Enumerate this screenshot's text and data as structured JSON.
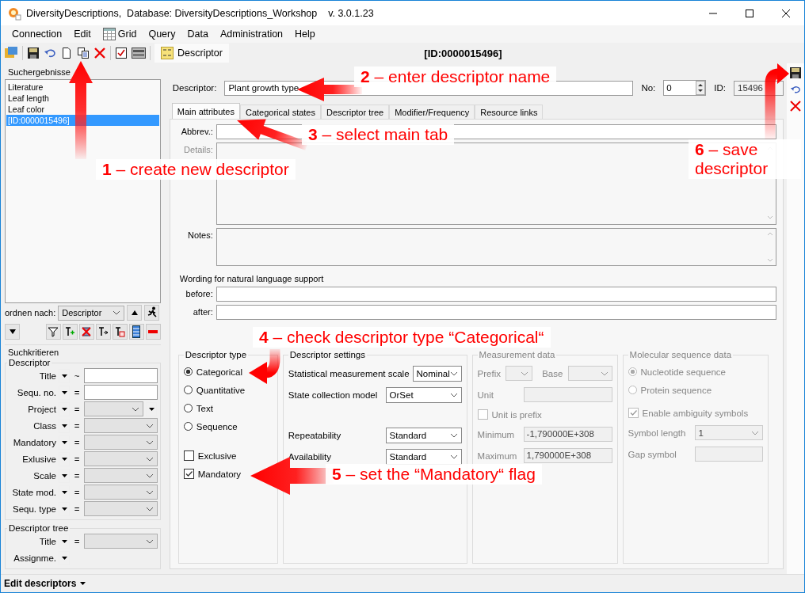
{
  "window": {
    "title": "DiversityDescriptions,  Database: DiversityDescriptions_Workshop    v. 3.0.1.23"
  },
  "menu": [
    {
      "label": "Connection",
      "has_icon": false
    },
    {
      "label": "Edit",
      "has_icon": false
    },
    {
      "label": "Grid",
      "has_icon": true
    },
    {
      "label": "Query",
      "has_icon": false
    },
    {
      "label": "Data",
      "has_icon": false
    },
    {
      "label": "Administration",
      "has_icon": false
    },
    {
      "label": "Help",
      "has_icon": false
    }
  ],
  "toolbar": {
    "tab": "Descriptor",
    "record_id": "[ID:0000015496]"
  },
  "search_results": {
    "title": "Suchergebnisse",
    "items": [
      {
        "label": "Literature",
        "selected": false
      },
      {
        "label": "Leaf length",
        "selected": false
      },
      {
        "label": "Leaf color",
        "selected": false
      },
      {
        "label": "[ID:0000015496]",
        "selected": true
      }
    ],
    "sort_label": "ordnen nach:",
    "sort_value": "Descriptor"
  },
  "search_criteria": {
    "title": "Suchkritieren",
    "groups": [
      {
        "title": "Descriptor",
        "rows": [
          {
            "label": "Title",
            "op": "~",
            "kind": "text"
          },
          {
            "label": "Sequ. no.",
            "op": "=",
            "kind": "text"
          },
          {
            "label": "Project",
            "op": "=",
            "kind": "combo-extra"
          },
          {
            "label": "Class",
            "op": "=",
            "kind": "combo"
          },
          {
            "label": "Mandatory",
            "op": "=",
            "kind": "combo"
          },
          {
            "label": "Exlusive",
            "op": "=",
            "kind": "combo"
          },
          {
            "label": "Scale",
            "op": "=",
            "kind": "combo"
          },
          {
            "label": "State mod.",
            "op": "=",
            "kind": "combo"
          },
          {
            "label": "Sequ. type",
            "op": "=",
            "kind": "combo"
          }
        ]
      },
      {
        "title": "Descriptor tree",
        "rows": [
          {
            "label": "Title",
            "op": "=",
            "kind": "combo"
          },
          {
            "label": "Assignme.",
            "kind": "none"
          }
        ]
      }
    ]
  },
  "descriptor": {
    "label": "Descriptor:",
    "value": "Plant growth type",
    "no_label": "No:",
    "no": "0",
    "id_label": "ID:",
    "id": "15496"
  },
  "tabs": [
    {
      "label": "Main attributes",
      "selected": true
    },
    {
      "label": "Categorical states",
      "selected": false
    },
    {
      "label": "Descriptor tree",
      "selected": false
    },
    {
      "label": "Modifier/Frequency",
      "selected": false
    },
    {
      "label": "Resource links",
      "selected": false
    }
  ],
  "main": {
    "abbrev_label": "Abbrev.:",
    "details_label": "Details:",
    "notes_label": "Notes:",
    "wording_title": "Wording for natural language support",
    "before_label": "before:",
    "after_label": "after:"
  },
  "descriptor_type": {
    "title": "Descriptor type",
    "options": [
      {
        "label": "Categorical",
        "selected": true
      },
      {
        "label": "Quantitative",
        "selected": false
      },
      {
        "label": "Text",
        "selected": false
      },
      {
        "label": "Sequence",
        "selected": false
      }
    ],
    "flags": [
      {
        "label": "Exclusive",
        "checked": false
      },
      {
        "label": "Mandatory",
        "checked": true
      }
    ]
  },
  "settings": {
    "title": "Descriptor settings",
    "fields": [
      {
        "label": "Statistical measurement scale",
        "value": "Nominal"
      },
      {
        "label": "State collection model",
        "value": "OrSet"
      },
      {
        "label": "Repeatability",
        "value": "Standard"
      },
      {
        "label": "Availability",
        "value": "Standard"
      }
    ]
  },
  "measurement": {
    "title": "Measurement data",
    "disabled": true,
    "prefix_label": "Prefix",
    "base_label": "Base",
    "unit_label": "Unit",
    "unit_is_prefix": {
      "label": "Unit is prefix",
      "checked": false
    },
    "min_label": "Minimum",
    "min": "-1,790000E+308",
    "max_label": "Maximum",
    "max": "1,790000E+308"
  },
  "sequence": {
    "title": "Molecular sequence data",
    "disabled": true,
    "options": [
      {
        "label": "Nucleotide sequence",
        "selected": true
      },
      {
        "label": "Protein sequence",
        "selected": false
      }
    ],
    "ambiguity": {
      "label": "Enable ambiguity symbols",
      "checked": true
    },
    "symbol_length_label": "Symbol length",
    "symbol_length": "1",
    "gap_label": "Gap symbol"
  },
  "status_bar": {
    "label": "Edit descriptors"
  },
  "annotations": [
    {
      "text": "**1** – create new descriptor"
    },
    {
      "text": "**2** – enter descriptor name"
    },
    {
      "text": "**3** – select main tab"
    },
    {
      "text": "**4** – check descriptor type “Categorical“"
    },
    {
      "text": "**5** – set the “Mandatory“ flag"
    },
    {
      "text": "**6** – save descriptor"
    }
  ]
}
